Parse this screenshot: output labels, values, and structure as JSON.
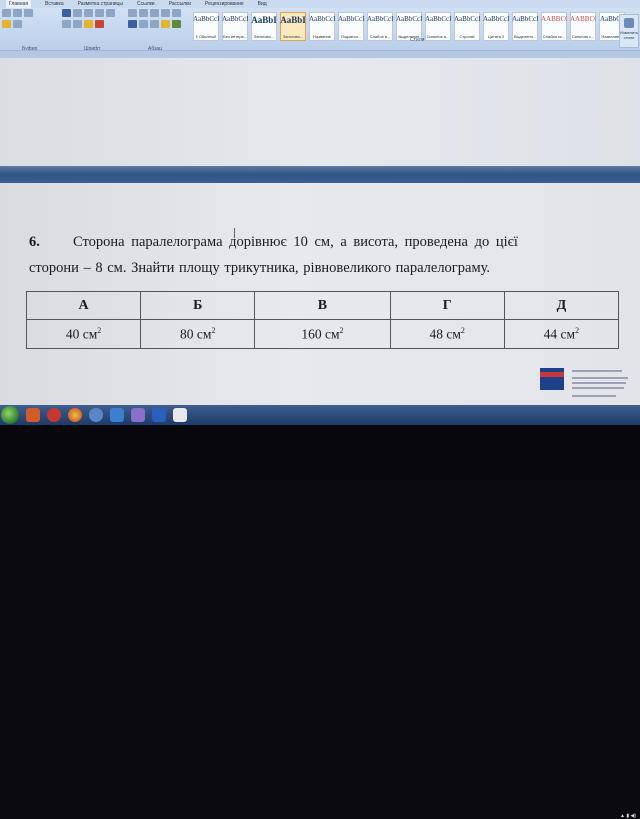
{
  "ribbon": {
    "tabs": [
      "Главная",
      "Вставка",
      "Разметка страницы",
      "Ссылки",
      "Рассылки",
      "Рецензирование",
      "Вид"
    ],
    "groups": {
      "clipboard": "Буфер",
      "font": "Шрифт",
      "paragraph": "Абзац",
      "styles": "Стили"
    },
    "styles": [
      {
        "sample": "AaBbCcI",
        "name": "¶ Обычный"
      },
      {
        "sample": "AaBbCcI",
        "name": "Без интерв..."
      },
      {
        "sample": "AaBbI",
        "name": "Заголово..."
      },
      {
        "sample": "AaBbI",
        "name": "Заголово..."
      },
      {
        "sample": "AaBbCcI",
        "name": "Название"
      },
      {
        "sample": "AaBbCcI",
        "name": "Подзагол..."
      },
      {
        "sample": "AaBbCcI",
        "name": "Слабое в..."
      },
      {
        "sample": "AaBbCcI",
        "name": "Выделение"
      },
      {
        "sample": "AaBbCcI",
        "name": "Сильное в..."
      },
      {
        "sample": "AaBbCcI",
        "name": "Строгий"
      },
      {
        "sample": "AaBbCcI",
        "name": "Цитата 2"
      },
      {
        "sample": "AaBbCcI",
        "name": "Выделенн..."
      },
      {
        "sample": "AABBCCI",
        "name": "Слабая сс..."
      },
      {
        "sample": "AABBCCI",
        "name": "Сильная с..."
      },
      {
        "sample": "AaBbCc",
        "name": "Название..."
      }
    ],
    "change_styles": "Изменить стили"
  },
  "problem": {
    "number": "6.",
    "line1": "Сторона паралелограма дорівнює 10 см, а висота, проведена до цієї",
    "line2": "сторони – 8 см. Знайти площу трикутника, рівновеликого паралелограму."
  },
  "answers": {
    "headers": [
      "А",
      "Б",
      "В",
      "Г",
      "Д"
    ],
    "values": [
      "40 см",
      "80 см",
      "160 см",
      "48 см",
      "44 см"
    ],
    "unit_power": "2"
  },
  "colors": {
    "ribbon": "#c3d6ee",
    "page_separator": "#2f5585",
    "taskbar": "#1f3a66",
    "text": "#1a1a22"
  }
}
